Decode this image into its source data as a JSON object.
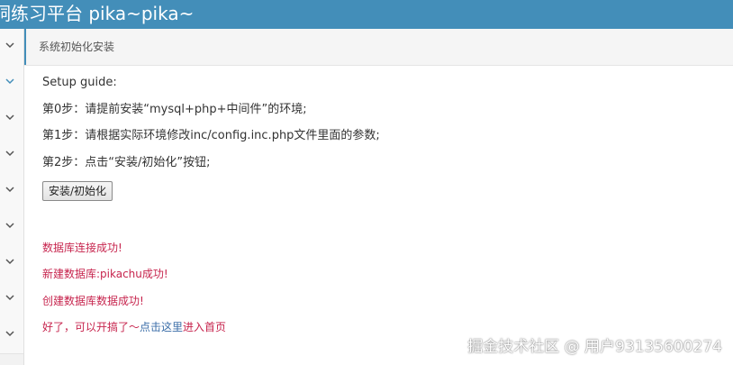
{
  "app": {
    "title": "洞练习平台 pika~pika~"
  },
  "breadcrumb": {
    "label": "系统初始化安装"
  },
  "sidebar": {
    "items": [
      {
        "icon": "chevron-down-icon"
      },
      {
        "icon": "chevron-down-icon"
      },
      {
        "icon": "chevron-down-icon"
      },
      {
        "icon": "chevron-down-icon"
      },
      {
        "icon": "chevron-down-icon"
      },
      {
        "icon": "chevron-down-icon"
      },
      {
        "icon": "chevron-down-icon"
      },
      {
        "icon": "chevron-down-icon"
      }
    ]
  },
  "guide": {
    "heading": "Setup guide:",
    "step0": "第0步：请提前安装“mysql+php+中间件”的环境;",
    "step1": "第1步：请根据实际环境修改inc/config.inc.php文件里面的参数;",
    "step2": "第2步：点击“安装/初始化”按钮;",
    "button_label": "安装/初始化"
  },
  "messages": {
    "db_connect": "数据库连接成功!",
    "db_create": "新建数据库:pikachu成功!",
    "data_create": "创建数据库数据成功!",
    "done_prefix": "好了，可以开搞了～",
    "done_link": "点击这里",
    "done_suffix": "进入首页"
  },
  "watermark": "掘金技术社区 @ 用户93135600274",
  "colors": {
    "topbar": "#438eb9",
    "message": "#c7254e",
    "link": "#3b6ea8"
  }
}
